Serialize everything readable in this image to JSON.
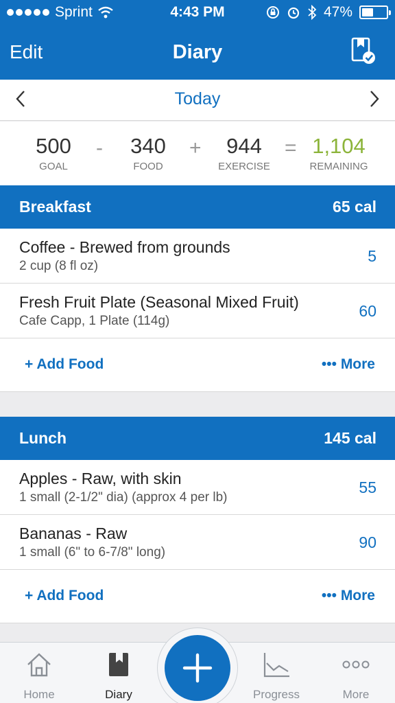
{
  "status_bar": {
    "carrier": "Sprint",
    "time": "4:43 PM",
    "battery": "47%",
    "battery_level": 0.47
  },
  "nav": {
    "edit_label": "Edit",
    "title": "Diary",
    "right_icon": "diary-complete-icon"
  },
  "date_nav": {
    "label": "Today",
    "prev_icon": "chevron-left-icon",
    "next_icon": "chevron-right-icon"
  },
  "summary": {
    "goal": "500",
    "goal_label": "GOAL",
    "op1": "-",
    "food": "340",
    "food_label": "FOOD",
    "op2": "+",
    "exercise": "944",
    "exercise_label": "EXERCISE",
    "op3": "=",
    "remaining": "1,104",
    "remaining_label": "REMAINING"
  },
  "meals": [
    {
      "name": "Breakfast",
      "calories": "65 cal",
      "items": [
        {
          "name": "Coffee - Brewed from grounds",
          "serving": "2 cup (8 fl oz)",
          "calories": "5"
        },
        {
          "name": "Fresh Fruit Plate (Seasonal Mixed Fruit)",
          "serving": "Cafe Capp, 1 Plate (114g)",
          "calories": "60"
        }
      ],
      "add_food_label": "+ Add Food",
      "more_label": "••• More"
    },
    {
      "name": "Lunch",
      "calories": "145 cal",
      "items": [
        {
          "name": "Apples - Raw, with skin",
          "serving": "1 small (2-1/2\" dia) (approx 4 per lb)",
          "calories": "55"
        },
        {
          "name": "Bananas - Raw",
          "serving": "1 small (6\" to 6-7/8\" long)",
          "calories": "90"
        }
      ],
      "add_food_label": "+ Add Food",
      "more_label": "••• More"
    }
  ],
  "tab_bar": {
    "tabs": [
      {
        "label": "Home",
        "icon": "home-icon"
      },
      {
        "label": "Diary",
        "icon": "diary-icon"
      },
      {
        "label": "Progress",
        "icon": "progress-chart-icon"
      },
      {
        "label": "More",
        "icon": "more-dots-icon"
      }
    ],
    "active": "Diary",
    "fab_icon": "plus-icon"
  },
  "colors": {
    "brand_blue": "#1170c0",
    "remaining_green": "#8cb43a",
    "background": "#ececee"
  }
}
